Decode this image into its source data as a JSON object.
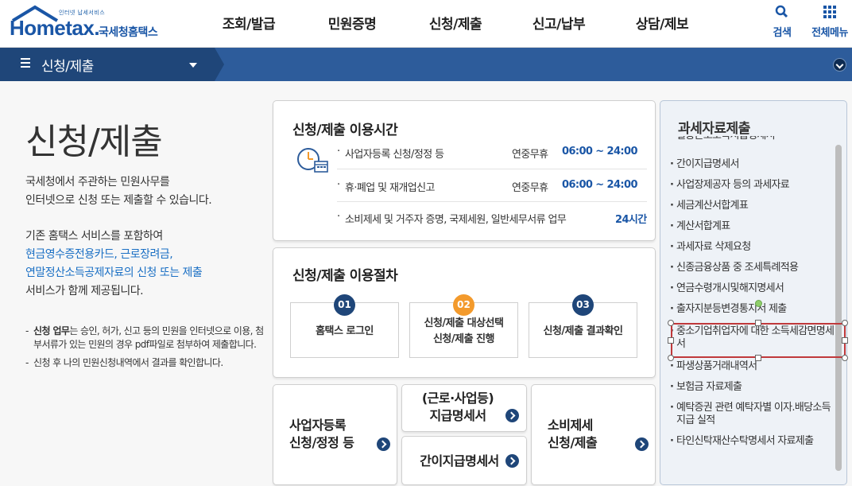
{
  "header": {
    "logo_tagline": "인터넷 납세서비스",
    "logo_word": "Hometax.",
    "logo_kr": "국세청홈택스",
    "menu": [
      "조회/발급",
      "민원증명",
      "신청/제출",
      "신고/납부",
      "상담/제보"
    ],
    "search_label": "검색",
    "allmenu_label": "전체메뉴"
  },
  "subbar": {
    "title": "신청/제출"
  },
  "intro": {
    "title": "신청/제출",
    "p1_line1": "국세청에서 주관하는 민원사무를",
    "p1_line2": "인터넷으로 신청 또는 제출할 수 있습니다.",
    "p2_line1": "기존 홈택스 서비스를 포함하여",
    "p2_blue1": "현금영수증전용카드, 근로장려금,",
    "p2_blue2": "연말정산소득공제자료의 신청 또는 제출",
    "p2_line4": "서비스가 함께 제공됩니다.",
    "note1_bold": "신청 업무",
    "note1_text": "는 승인, 허가, 신고 등의 민원을 인터넷으로 이용, 첨부서류가 있는 민원의 경우 pdf파일로 첨부하여 제출합니다.",
    "note2": "신청 후 나의 민원신청내역에서 결과를 확인합니다."
  },
  "hours": {
    "title": "신청/제출 이용시간",
    "rows": [
      {
        "name": "사업자등록 신청/정정 등",
        "period": "연중무휴",
        "time": "06:00 ~ 24:00"
      },
      {
        "name": "휴·폐업 및 재개업신고",
        "period": "연중무휴",
        "time": "06:00 ~ 24:00"
      },
      {
        "name": "소비제세 및 거주자 증명, 국제세원, 일반세무서류 업무",
        "period": "",
        "time": "24시간"
      }
    ]
  },
  "process": {
    "title": "신청/제출 이용절차",
    "steps": [
      {
        "num": "01",
        "line1": "홈택스 로그인",
        "line2": "",
        "color": "#1f4679"
      },
      {
        "num": "02",
        "line1": "신청/제출 대상선택",
        "line2": "신청/제출 진행",
        "color": "#f39a2c"
      },
      {
        "num": "03",
        "line1": "신청/제출 결과확인",
        "line2": "",
        "color": "#1f4679"
      }
    ]
  },
  "shortcuts": {
    "biz_line1": "사업자등록",
    "biz_line2": "신청/정정 등",
    "wage_line1": "(근로·사업등)",
    "wage_line2": "지급명세서",
    "simple": "간이지급명세서",
    "consumer_line1": "소비제세",
    "consumer_line2": "신청/제출"
  },
  "right_panel": {
    "title": "과세자료제출",
    "cut_item": "일용근로소득지급명세서",
    "items": [
      "간이지급명세서",
      "사업장제공자 등의 과세자료",
      "세금계산서합계표",
      "계산서합계표",
      "과세자료 삭제요청",
      "신종금융상품 중 조세특례적용",
      "연금수령개시및해지명세서",
      "출자지분등변경통지서 제출",
      "중소기업취업자에 대한 소득세감면명세서",
      "파생상품거래내역서",
      "보험금 자료제출",
      "예탁증권 관련 예탁자별 이자.배당소득 지급 실적",
      "타인신탁재산수탁명세서 자료제출"
    ]
  },
  "colors": {
    "brand": "#1a56a6",
    "nav_dark": "#1f4679",
    "nav_bar": "#2d5c9b",
    "orange": "#f39a2c",
    "selection": "#c0393b"
  }
}
